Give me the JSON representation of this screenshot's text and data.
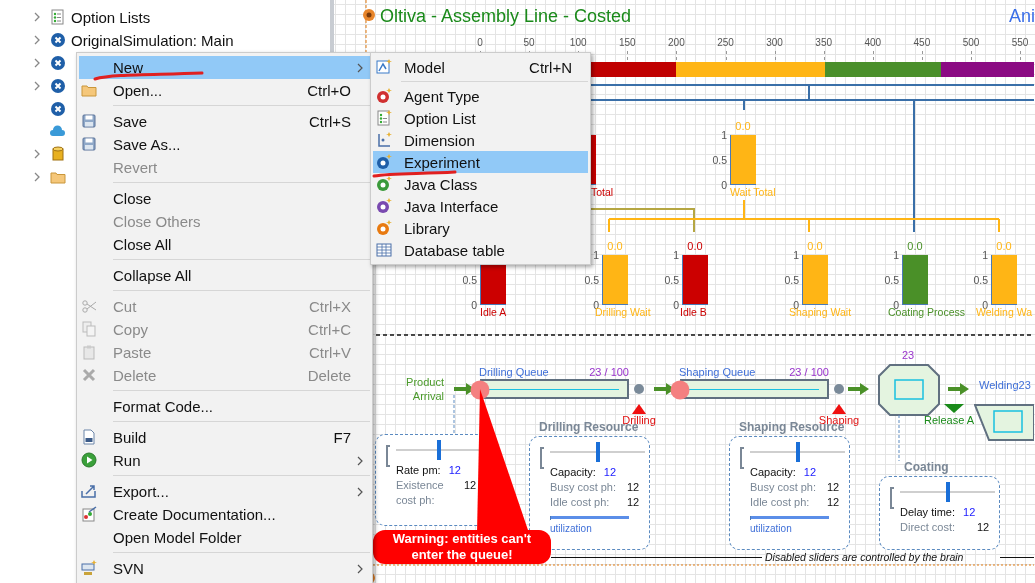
{
  "tree": [
    {
      "label": "Option Lists",
      "expandable": true
    },
    {
      "label": "OriginalSimulation: Main",
      "expandable": true
    },
    {
      "expandable": true
    },
    {
      "expandable": true
    },
    {
      "expandable": false
    },
    {
      "expandable": false
    },
    {
      "expandable": true
    },
    {
      "expandable": true
    }
  ],
  "context_menu": [
    {
      "kind": "item",
      "label": "New",
      "has_submenu": true,
      "disabled": false,
      "selected": true
    },
    {
      "kind": "item",
      "label": "Open...",
      "shortcut": "Ctrl+O",
      "disabled": false,
      "selected": false
    },
    {
      "kind": "separator"
    },
    {
      "kind": "item",
      "label": "Save",
      "shortcut": "Ctrl+S",
      "disabled": false,
      "selected": false
    },
    {
      "kind": "item",
      "label": "Save As...",
      "disabled": false,
      "selected": false
    },
    {
      "kind": "item",
      "label": "Revert",
      "disabled": true,
      "selected": false
    },
    {
      "kind": "separator"
    },
    {
      "kind": "item",
      "label": "Close",
      "disabled": false,
      "selected": false
    },
    {
      "kind": "item",
      "label": "Close Others",
      "disabled": true,
      "selected": false
    },
    {
      "kind": "item",
      "label": "Close All",
      "disabled": false,
      "selected": false
    },
    {
      "kind": "separator"
    },
    {
      "kind": "item",
      "label": "Collapse All",
      "disabled": false,
      "selected": false
    },
    {
      "kind": "separator"
    },
    {
      "kind": "item",
      "label": "Cut",
      "shortcut": "Ctrl+X",
      "disabled": true,
      "selected": false
    },
    {
      "kind": "item",
      "label": "Copy",
      "shortcut": "Ctrl+C",
      "disabled": true,
      "selected": false
    },
    {
      "kind": "item",
      "label": "Paste",
      "shortcut": "Ctrl+V",
      "disabled": true,
      "selected": false
    },
    {
      "kind": "item",
      "label": "Delete",
      "shortcut": "Delete",
      "disabled": true,
      "selected": false
    },
    {
      "kind": "separator"
    },
    {
      "kind": "item",
      "label": "Format Code...",
      "disabled": false,
      "selected": false
    },
    {
      "kind": "separator"
    },
    {
      "kind": "item",
      "label": "Build",
      "shortcut": "F7",
      "disabled": false,
      "selected": false
    },
    {
      "kind": "item",
      "label": "Run",
      "has_submenu": true,
      "disabled": false,
      "selected": false
    },
    {
      "kind": "separator"
    },
    {
      "kind": "item",
      "label": "Export...",
      "has_submenu": true,
      "disabled": false,
      "selected": false
    },
    {
      "kind": "item",
      "label": "Create Documentation...",
      "disabled": false,
      "selected": false
    },
    {
      "kind": "item",
      "label": "Open Model Folder",
      "disabled": false,
      "selected": false
    },
    {
      "kind": "separator"
    },
    {
      "kind": "item",
      "label": "SVN",
      "has_submenu": true,
      "disabled": false,
      "selected": false
    }
  ],
  "submenu": [
    {
      "kind": "item",
      "label": "Model",
      "shortcut": "Ctrl+N",
      "disabled": false,
      "selected": false
    },
    {
      "kind": "separator"
    },
    {
      "kind": "item",
      "label": "Agent Type",
      "disabled": false,
      "selected": false
    },
    {
      "kind": "item",
      "label": "Option List",
      "disabled": false,
      "selected": false
    },
    {
      "kind": "item",
      "label": "Dimension",
      "disabled": false,
      "selected": false
    },
    {
      "kind": "item",
      "label": "Experiment",
      "disabled": false,
      "selected": true
    },
    {
      "kind": "item",
      "label": "Java Class",
      "disabled": false,
      "selected": false
    },
    {
      "kind": "item",
      "label": "Java Interface",
      "disabled": false,
      "selected": false
    },
    {
      "kind": "item",
      "label": "Library",
      "disabled": false,
      "selected": false
    },
    {
      "kind": "item",
      "label": "Database table",
      "disabled": false,
      "selected": false
    }
  ],
  "canvas": {
    "title": "Oltiva - Assembly Line - Costed",
    "link": "Ani",
    "ruler": [
      "0",
      "50",
      "100",
      "150",
      "200",
      "250",
      "300",
      "350",
      "400",
      "450",
      "500",
      "550"
    ],
    "timeline": [
      {
        "color": "#c00000"
      },
      {
        "color": "#ffb515"
      },
      {
        "color": "#4a8f2a"
      },
      {
        "color": "#8b0a83"
      }
    ],
    "gauges": [
      {
        "label": "Total",
        "color": "#cc0000",
        "level": 1
      },
      {
        "value": "0.0",
        "ticks": [
          "1",
          "0.5",
          "0"
        ],
        "label": "Wait Total",
        "color": "#ffb515",
        "level": 1
      },
      {
        "ticks": [
          "0.5",
          "0"
        ],
        "label": "Idle A",
        "color": "#cc0000",
        "level": 1
      },
      {
        "value": "0.0",
        "ticks": [
          "1",
          "0.5",
          "0"
        ],
        "label": "Drilling Wait",
        "color": "#ffb515",
        "level": 1
      },
      {
        "value": "0.0",
        "ticks": [
          "1",
          "0.5",
          "0"
        ],
        "label": "Idle B",
        "color": "#cc0000",
        "level": 1
      },
      {
        "value": "0.0",
        "ticks": [
          "1",
          "0.5",
          "0"
        ],
        "label": "Shaping Wait",
        "color": "#ffb515",
        "level": 1
      },
      {
        "value": "0.0",
        "ticks": [
          "1",
          "0.5",
          "0"
        ],
        "label": "Coating Process",
        "color": "#4a9028",
        "level": 1
      },
      {
        "value": "0.0",
        "ticks": [
          "1",
          "0.5",
          "0"
        ],
        "label": "Welding Wa",
        "color": "#ffb515",
        "level": 1
      }
    ],
    "flow": {
      "source": "Product Arrival",
      "queues": [
        {
          "label": "Drilling Queue",
          "count": "23 / 100"
        },
        {
          "label": "Shaping Queue",
          "count": "23 / 100"
        }
      ],
      "seizes": [
        "Drilling",
        "Shaping"
      ],
      "delay_count": "23",
      "release": "Release A",
      "welding": "Welding23"
    },
    "panels": [
      {
        "level": 0.5,
        "rows": [
          {
            "kind": "parameter",
            "label": "Rate pm:",
            "value": "12"
          },
          {
            "kind": "cost",
            "label": "Existence cost ph:",
            "value": "12"
          }
        ]
      },
      {
        "title": "Drilling Resource",
        "level": 0.5,
        "rows": [
          {
            "kind": "parameter",
            "label": "Capacity:",
            "value": "12"
          },
          {
            "kind": "cost",
            "label": "Busy cost ph:",
            "value": "12"
          },
          {
            "kind": "cost",
            "label": "Idle cost ph:",
            "value": "12"
          }
        ],
        "utilization": {
          "label": "utilization",
          "level": 1
        }
      },
      {
        "title": "Shaping Resource",
        "level": 0.5,
        "rows": [
          {
            "kind": "parameter",
            "label": "Capacity:",
            "value": "12"
          },
          {
            "kind": "cost",
            "label": "Busy cost ph:",
            "value": "12"
          },
          {
            "kind": "cost",
            "label": "Idle cost ph:",
            "value": "12"
          }
        ],
        "utilization": {
          "label": "utilization",
          "level": 1
        }
      },
      {
        "title": "Coating",
        "level": 0.5,
        "rows": [
          {
            "kind": "parameter",
            "label": "Delay time:",
            "value": "12"
          },
          {
            "kind": "cost",
            "label": "Direct cost:",
            "value": "12"
          }
        ]
      }
    ],
    "warning": "Warning: entities can't enter the queue!",
    "footnote": "Disabled sliders are controlled by the brain"
  }
}
